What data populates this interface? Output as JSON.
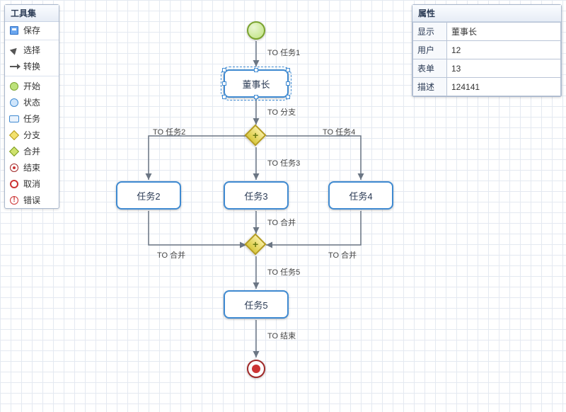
{
  "toolbox": {
    "title": "工具集",
    "save": "保存",
    "select": "选择",
    "transition": "转换",
    "start": "开始",
    "state": "状态",
    "task": "任务",
    "fork": "分支",
    "join": "合并",
    "end": "结束",
    "cancel": "取消",
    "error": "错误"
  },
  "properties": {
    "title": "属性",
    "display_key": "显示",
    "display_val": "董事长",
    "user_key": "用户",
    "user_val": "12",
    "form_key": "表单",
    "form_val": "13",
    "desc_key": "描述",
    "desc_val": "124141"
  },
  "nodes": {
    "chairman": "董事长",
    "task2": "任务2",
    "task3": "任务3",
    "task4": "任务4",
    "task5": "任务5",
    "plus": "+"
  },
  "edges": {
    "to_task1": "TO 任务1",
    "to_fork": "TO 分支",
    "to_task2": "TO 任务2",
    "to_task3": "TO 任务3",
    "to_task4": "TO 任务4",
    "to_join": "TO 合并",
    "to_task5": "TO 任务5",
    "to_end": "TO 结束"
  },
  "chart_data": {
    "type": "bpmn-flowchart",
    "nodes": [
      {
        "id": "start",
        "type": "start"
      },
      {
        "id": "task1",
        "type": "task",
        "label": "董事长",
        "selected": true
      },
      {
        "id": "fork",
        "type": "gateway",
        "subtype": "fork"
      },
      {
        "id": "task2",
        "type": "task",
        "label": "任务2"
      },
      {
        "id": "task3",
        "type": "task",
        "label": "任务3"
      },
      {
        "id": "task4",
        "type": "task",
        "label": "任务4"
      },
      {
        "id": "join",
        "type": "gateway",
        "subtype": "join"
      },
      {
        "id": "task5",
        "type": "task",
        "label": "任务5"
      },
      {
        "id": "end",
        "type": "end"
      }
    ],
    "edges": [
      {
        "from": "start",
        "to": "task1",
        "label": "TO 任务1"
      },
      {
        "from": "task1",
        "to": "fork",
        "label": "TO 分支"
      },
      {
        "from": "fork",
        "to": "task2",
        "label": "TO 任务2"
      },
      {
        "from": "fork",
        "to": "task3",
        "label": "TO 任务3"
      },
      {
        "from": "fork",
        "to": "task4",
        "label": "TO 任务4"
      },
      {
        "from": "task2",
        "to": "join",
        "label": "TO 合并"
      },
      {
        "from": "task3",
        "to": "join",
        "label": "TO 合并"
      },
      {
        "from": "task4",
        "to": "join",
        "label": "TO 合并"
      },
      {
        "from": "join",
        "to": "task5",
        "label": "TO 任务5"
      },
      {
        "from": "task5",
        "to": "end",
        "label": "TO 结束"
      }
    ]
  }
}
